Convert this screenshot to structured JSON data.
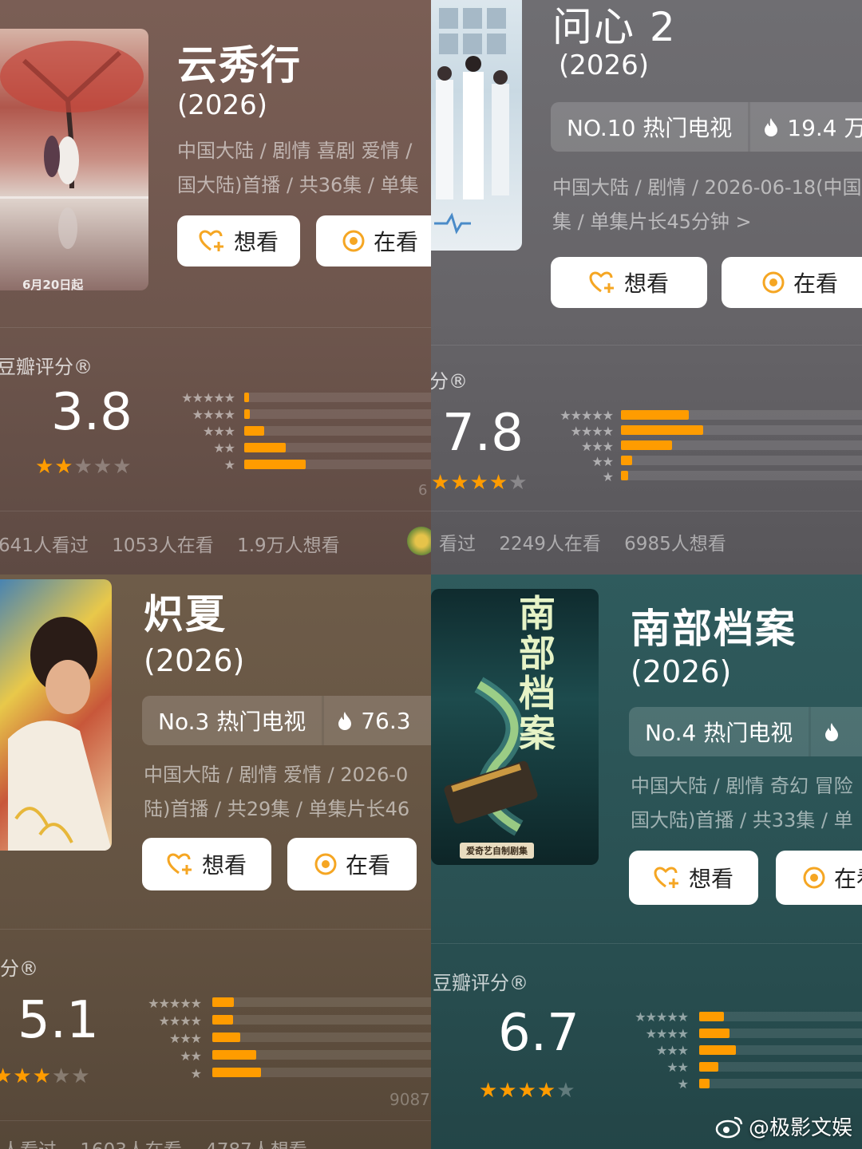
{
  "panels": [
    {
      "title": "云秀行",
      "year": "(2026)",
      "meta_line1": "中国大陆 / 剧情 喜剧 爱情 /",
      "meta_line2": "国大陆)首播 / 共36集 / 单集",
      "want_label": "想看",
      "watching_label": "在看",
      "poster_date": "6月20日起",
      "rating_label": "豆瓣评分®",
      "score": "3.8",
      "star_fill": 2,
      "distribution": [
        0.017,
        0.027,
        0.09,
        0.19,
        0.28
      ],
      "rating_count": "6",
      "stats": [
        "641人看过",
        "1053人在看",
        "1.9万人想看"
      ]
    },
    {
      "title": "问心 2",
      "year": "(2026)",
      "rank_label": "NO.10 热门电视",
      "heat": "19.4 万",
      "meta_line1": "中国大陆 / 剧情 / 2026-06-18(中国",
      "meta_line2": "集 / 单集片长45分钟 >",
      "want_label": "想看",
      "watching_label": "在看",
      "rating_label": "分®",
      "score": "7.8",
      "star_fill": 4,
      "distribution": [
        0.24,
        0.29,
        0.18,
        0.04,
        0.025
      ],
      "stats": [
        "看过",
        "2249人在看",
        "6985人想看"
      ]
    },
    {
      "title": "炽夏",
      "year": "(2026)",
      "rank_label": "No.3 热门电视",
      "heat": "76.3",
      "meta_line1": "中国大陆 / 剧情 爱情 / 2026-0",
      "meta_line2": "陆)首播 / 共29集 / 单集片长46",
      "want_label": "想看",
      "watching_label": "在看",
      "rating_label": "评分®",
      "score": "5.1",
      "star_fill": 2.5,
      "distribution": [
        0.085,
        0.08,
        0.11,
        0.17,
        0.19
      ],
      "rating_count": "9087",
      "stats": [
        "人看过",
        "1603人在看",
        "4787人想看"
      ]
    },
    {
      "title": "南部档案",
      "year": "(2026)",
      "rank_label": "No.4 热门电视",
      "meta_line1": "中国大陆 / 剧情 奇幻 冒险",
      "meta_line2": "国大陆)首播 / 共33集 / 单",
      "want_label": "想看",
      "watching_label": "在看",
      "poster_caption": "爱奇艺自制剧集",
      "poster_title": "南部档案",
      "rating_label": "豆瓣评分®",
      "score": "6.7",
      "star_fill": 3.5,
      "distribution": [
        0.13,
        0.16,
        0.19,
        0.1,
        0.055
      ]
    }
  ],
  "watermark": "@极影文娱",
  "colors": {
    "accent": "#ff9c00",
    "want_icon": "#f5a623",
    "watch_icon": "#f5a623"
  }
}
